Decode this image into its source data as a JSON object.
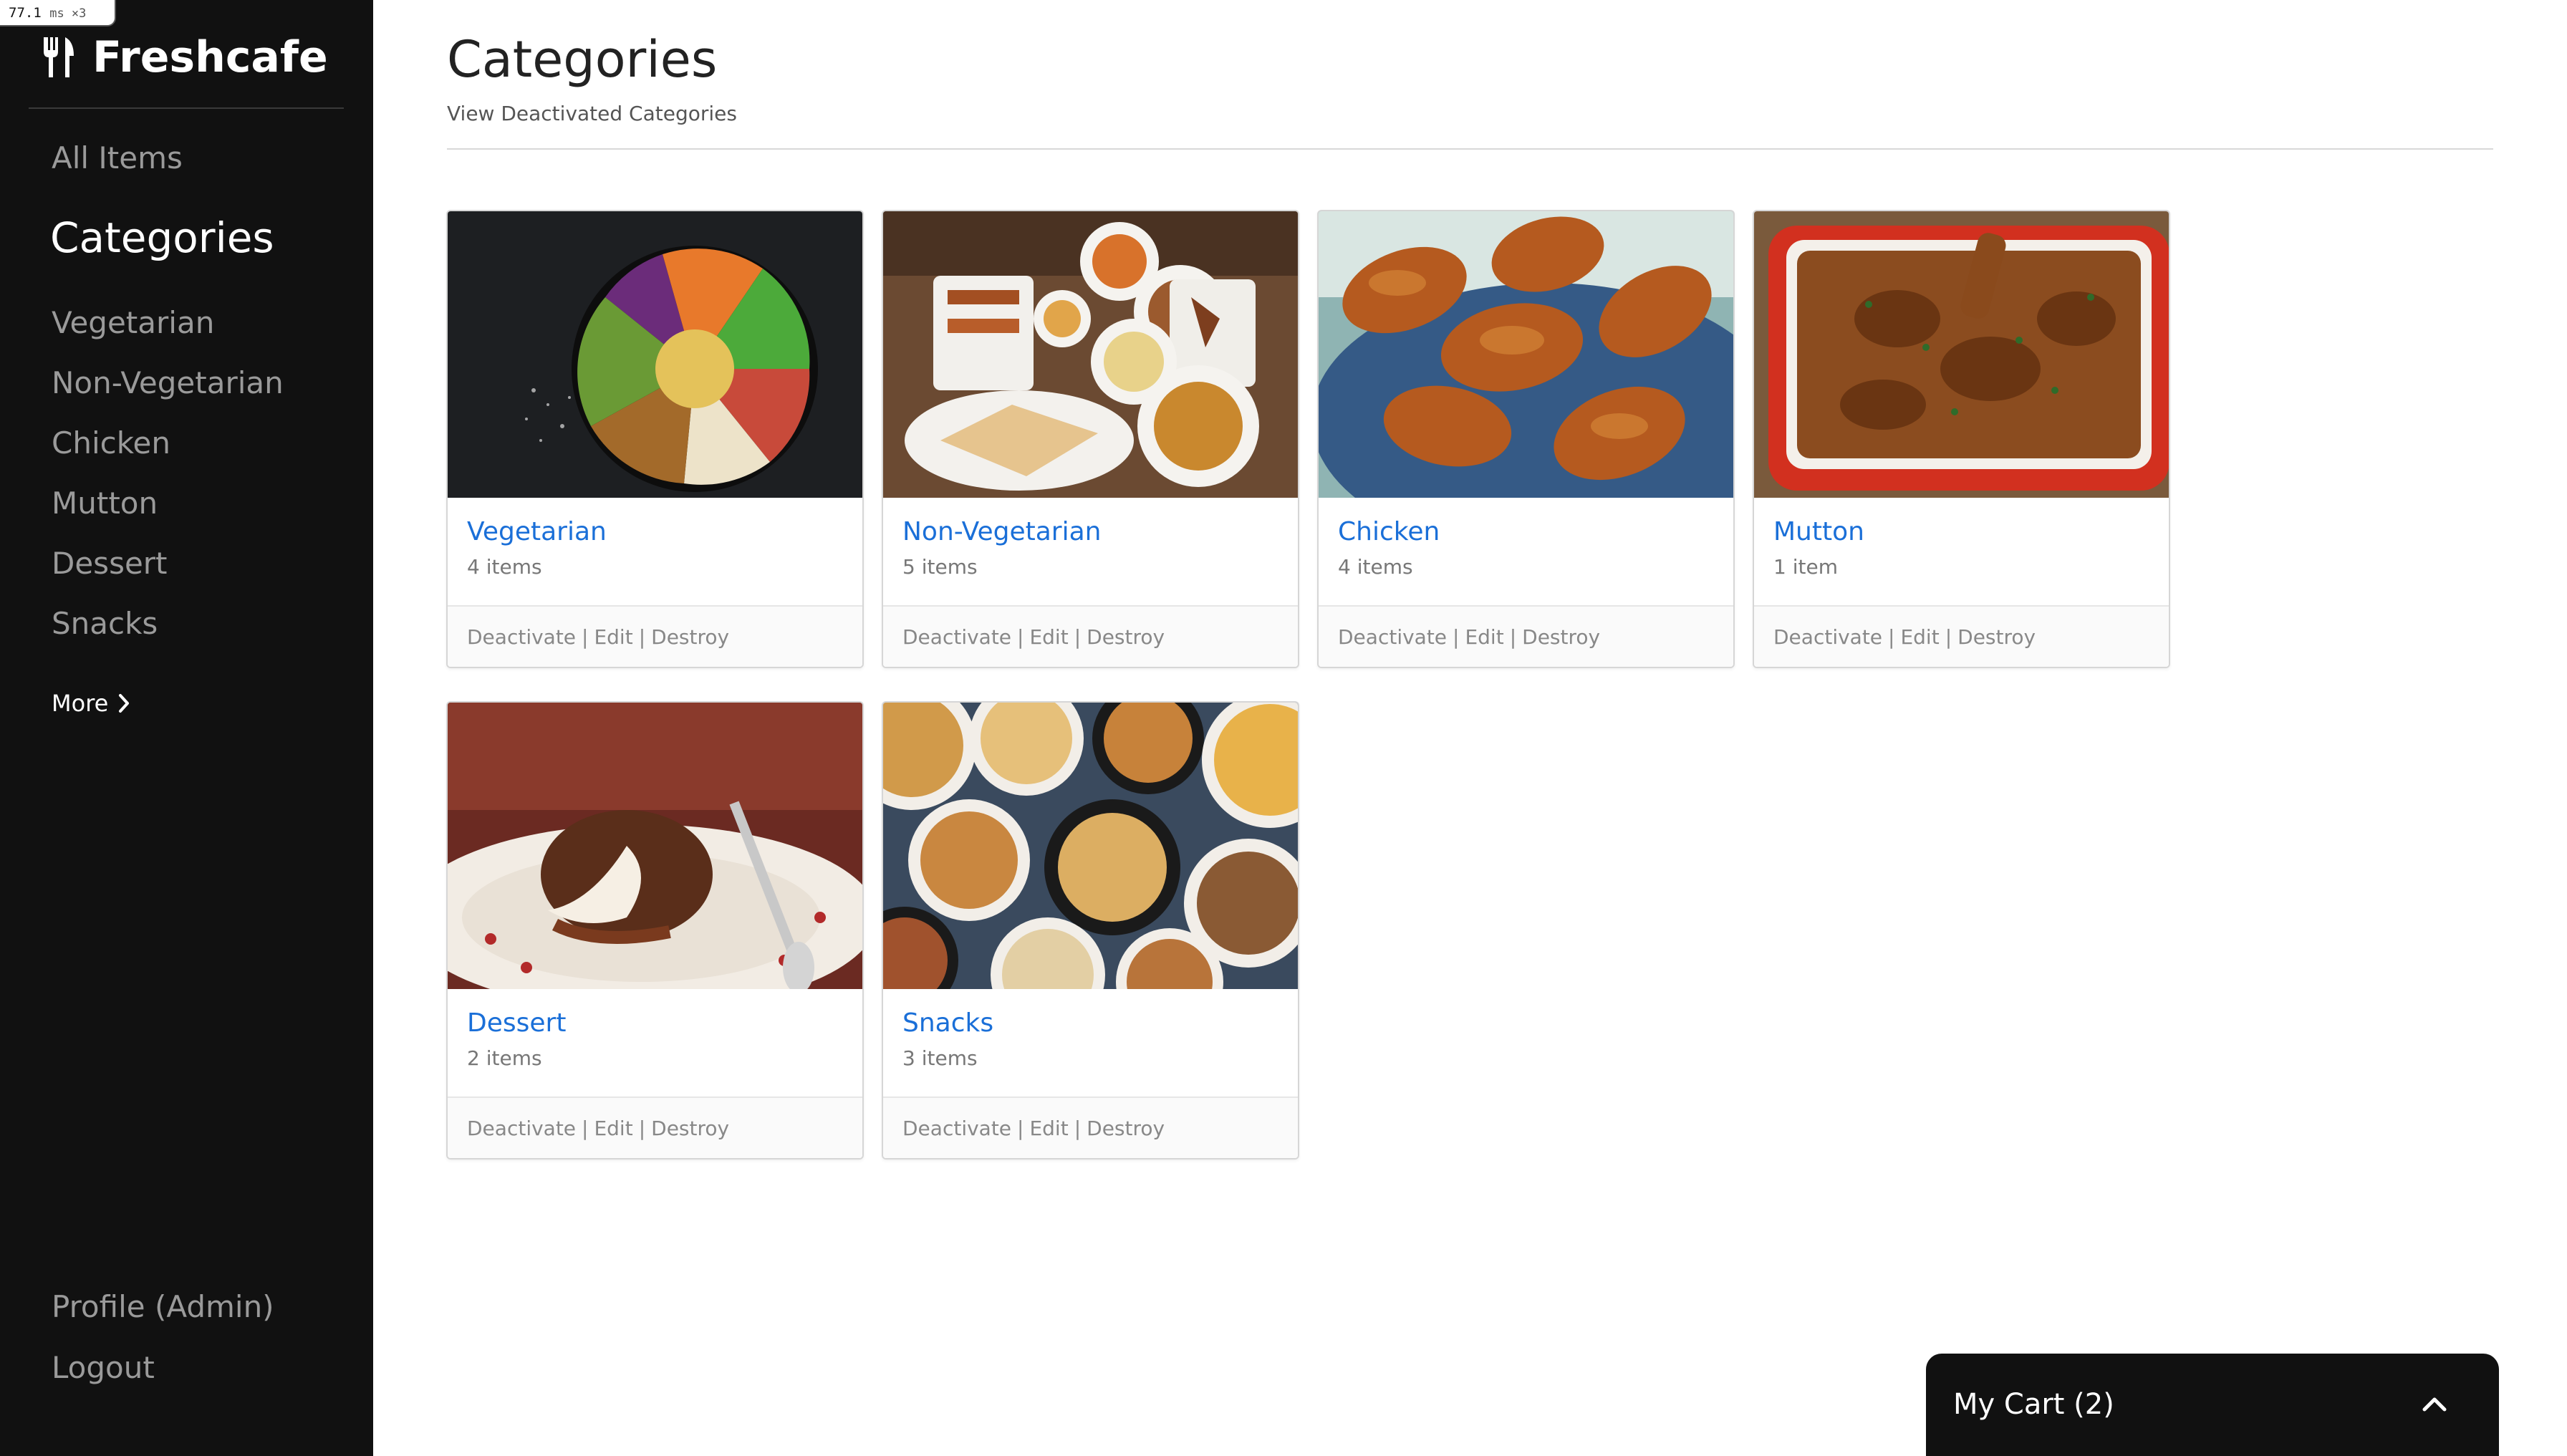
{
  "perf_badge": {
    "value": "77.1",
    "unit": "ms ×3"
  },
  "brand": {
    "name": "Freshcafe",
    "icon": "fork-knife-icon"
  },
  "sidebar": {
    "all_items": "All Items",
    "categories_heading": "Categories",
    "categories": [
      "Vegetarian",
      "Non-Vegetarian",
      "Chicken",
      "Mutton",
      "Dessert",
      "Snacks"
    ],
    "more": "More",
    "profile": "Profile (Admin)",
    "logout": "Logout"
  },
  "main": {
    "title": "Categories",
    "view_deactivated": "View Deactivated Categories"
  },
  "cards": [
    {
      "name": "Vegetarian",
      "count": "4 items",
      "image": "vegetarian-bowl"
    },
    {
      "name": "Non-Vegetarian",
      "count": "5 items",
      "image": "non-veg-platter"
    },
    {
      "name": "Chicken",
      "count": "4 items",
      "image": "chicken-drumsticks"
    },
    {
      "name": "Mutton",
      "count": "1 item",
      "image": "mutton-curry"
    },
    {
      "name": "Dessert",
      "count": "2 items",
      "image": "lava-cake"
    },
    {
      "name": "Snacks",
      "count": "3 items",
      "image": "snack-bowls"
    }
  ],
  "card_actions": {
    "deactivate": "Deactivate",
    "edit": "Edit",
    "destroy": "Destroy",
    "separator": "|"
  },
  "cart": {
    "label": "My Cart (2)",
    "icon": "chevron-up-icon"
  },
  "colors": {
    "sidebar_bg": "#111111",
    "link_blue": "#1a6fd8",
    "muted_text": "#9a9a9a"
  }
}
